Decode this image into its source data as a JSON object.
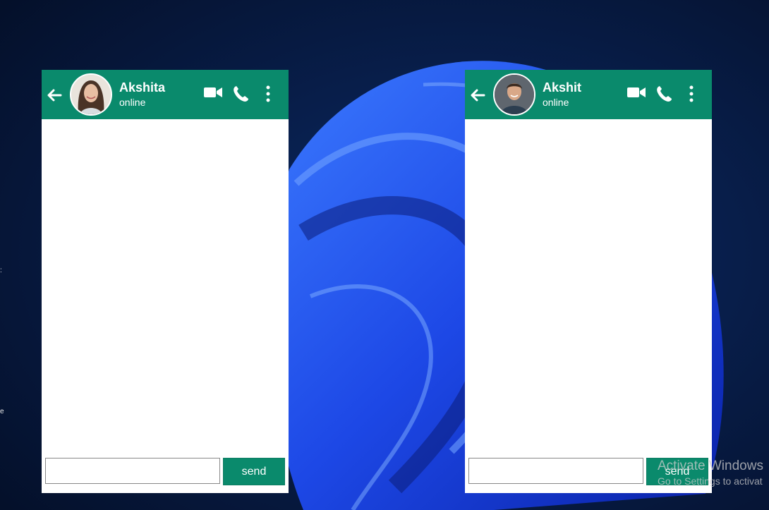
{
  "chats": [
    {
      "contact_name": "Akshita",
      "status": "online",
      "input_value": "",
      "send_label": "send"
    },
    {
      "contact_name": "Akshit",
      "status": "online",
      "input_value": "",
      "send_label": "send"
    }
  ],
  "watermark": {
    "title": "Activate Windows",
    "subtitle": "Go to Settings to activat"
  },
  "icons": [
    "back-arrow-icon",
    "video-call-icon",
    "phone-icon",
    "more-options-icon"
  ],
  "colors": {
    "header": "#0a8a6c",
    "send_button": "#0a8a6c",
    "desktop_background": "#061634",
    "wallpaper_accent": "#2a5cff"
  }
}
